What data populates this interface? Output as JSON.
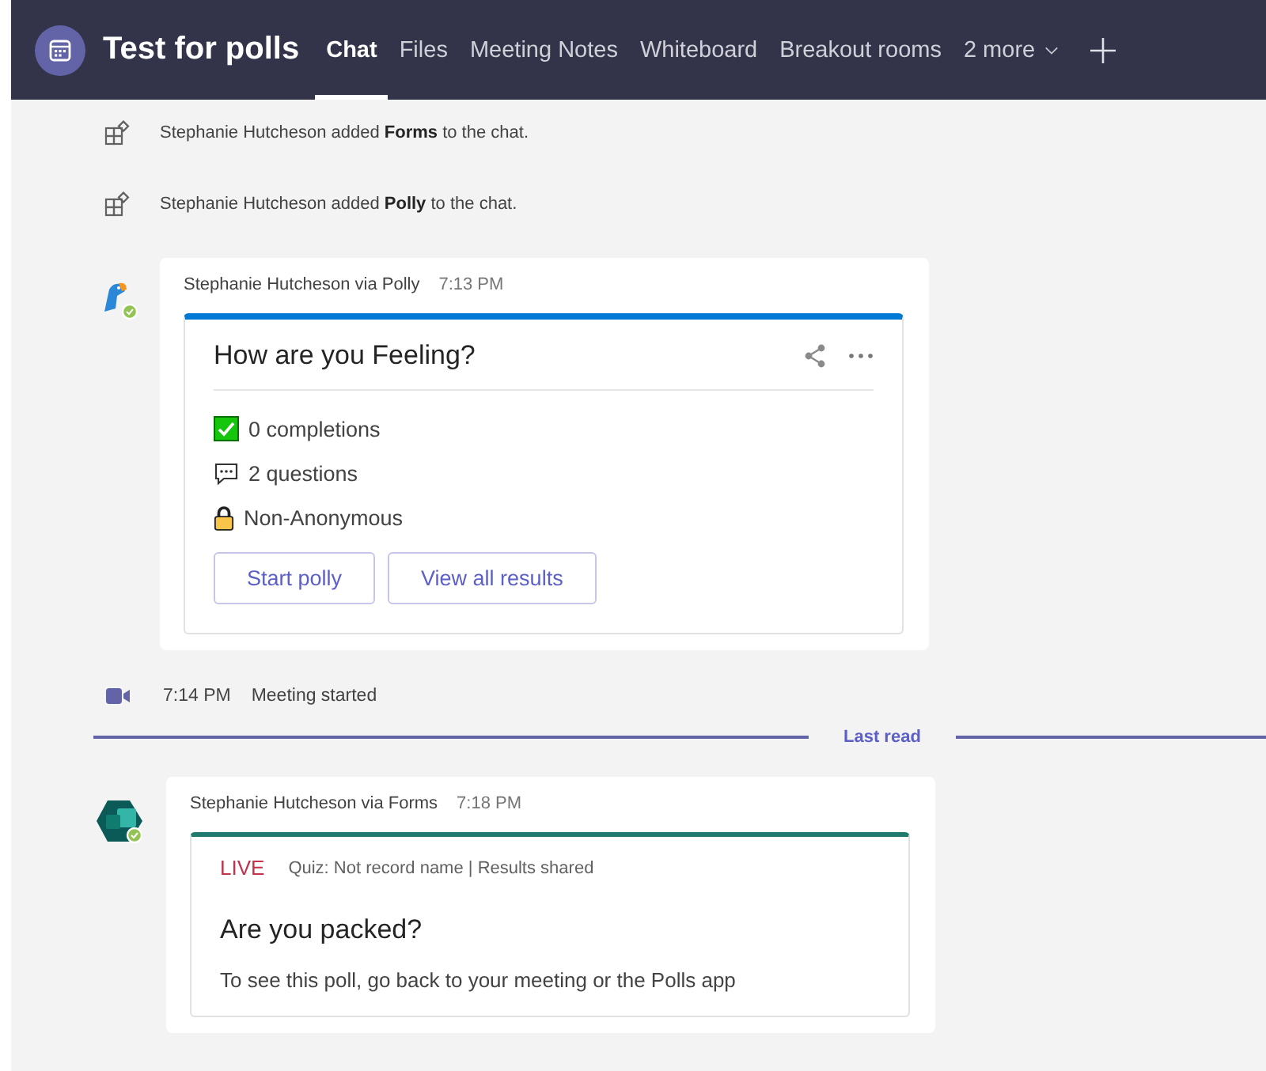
{
  "header": {
    "title": "Test for polls",
    "tabs": [
      {
        "label": "Chat",
        "selected": true
      },
      {
        "label": "Files",
        "selected": false
      },
      {
        "label": "Meeting Notes",
        "selected": false
      },
      {
        "label": "Whiteboard",
        "selected": false
      },
      {
        "label": "Breakout rooms",
        "selected": false
      }
    ],
    "more": "2 more"
  },
  "system_messages": [
    {
      "text": "Stephanie Hutcheson added **Forms** to the chat."
    },
    {
      "text": "Stephanie Hutcheson added **Polly** to the chat."
    }
  ],
  "poll_message": {
    "sender": "Stephanie Hutcheson via Polly",
    "time": "7:13 PM",
    "card": {
      "title": "How are you Feeling?",
      "stats": [
        {
          "kind": "check",
          "text": "0 completions"
        },
        {
          "kind": "speech",
          "text": "2 questions"
        },
        {
          "kind": "lock",
          "text": "Non-Anonymous"
        }
      ],
      "buttons": [
        "Start polly",
        "View all results"
      ]
    }
  },
  "meeting_event": {
    "time": "7:14 PM",
    "text": "Meeting started"
  },
  "divider": {
    "label": "Last read"
  },
  "forms_message": {
    "sender": "Stephanie Hutcheson via Forms",
    "time": "7:18 PM",
    "card": {
      "status": "LIVE",
      "meta": "Quiz: Not record name | Results shared",
      "title": "Are you packed?",
      "body": "To see this poll, go back to your meeting or the Polls app"
    }
  }
}
